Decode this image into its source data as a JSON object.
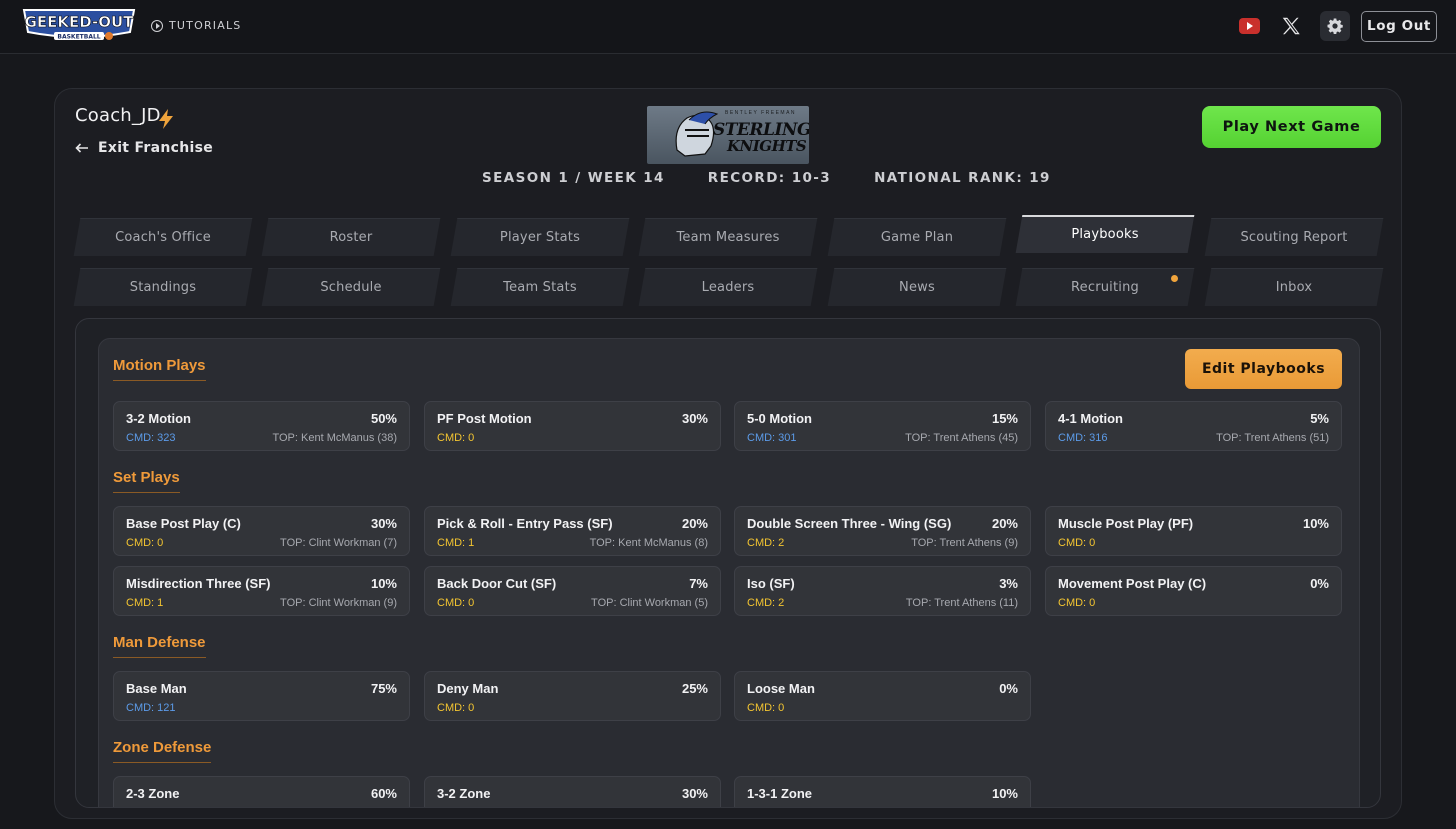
{
  "header": {
    "tutorials_label": "TUTORIALS",
    "logout_label": "Log Out",
    "icons": [
      "youtube-icon",
      "x-icon",
      "gear-icon"
    ]
  },
  "franchise": {
    "coach_name": "Coach_JD",
    "exit_label": "Exit Franchise",
    "team_logo_line0": "BENTLEY FREEMAN",
    "team_logo_line1": "STERLING",
    "team_logo_line2": "KNIGHTS",
    "season": "SEASON 1 / WEEK 14",
    "record": "RECORD: 10-3",
    "rank": "NATIONAL RANK: 19",
    "play_next_label": "Play Next Game"
  },
  "tabs_row1": [
    "Coach's Office",
    "Roster",
    "Player Stats",
    "Team Measures",
    "Game Plan",
    "Playbooks",
    "Scouting Report"
  ],
  "tabs_row2": [
    "Standings",
    "Schedule",
    "Team Stats",
    "Leaders",
    "News",
    "Recruiting",
    "Inbox"
  ],
  "active_tab": "Playbooks",
  "edit_label": "Edit Playbooks",
  "sections": {
    "motion": {
      "title": "Motion Plays",
      "cards": [
        {
          "name": "3-2 Motion",
          "pct": "50%",
          "cmd": "CMD: 323",
          "top": "TOP: Kent McManus (38)"
        },
        {
          "name": "PF Post Motion",
          "pct": "30%",
          "cmd": "CMD: 0",
          "top": ""
        },
        {
          "name": "5-0 Motion",
          "pct": "15%",
          "cmd": "CMD: 301",
          "top": "TOP: Trent Athens (45)"
        },
        {
          "name": "4-1 Motion",
          "pct": "5%",
          "cmd": "CMD: 316",
          "top": "TOP: Trent Athens (51)"
        }
      ]
    },
    "set": {
      "title": "Set Plays",
      "cards": [
        {
          "name": "Base Post Play (C)",
          "pct": "30%",
          "cmd": "CMD: 0",
          "top": "TOP: Clint Workman (7)"
        },
        {
          "name": "Pick & Roll - Entry Pass (SF)",
          "pct": "20%",
          "cmd": "CMD: 1",
          "top": "TOP: Kent McManus (8)"
        },
        {
          "name": "Double Screen Three - Wing (SG)",
          "pct": "20%",
          "cmd": "CMD: 2",
          "top": "TOP: Trent Athens (9)"
        },
        {
          "name": "Muscle Post Play (PF)",
          "pct": "10%",
          "cmd": "CMD: 0",
          "top": ""
        },
        {
          "name": "Misdirection Three (SF)",
          "pct": "10%",
          "cmd": "CMD: 1",
          "top": "TOP: Clint Workman (9)"
        },
        {
          "name": "Back Door Cut (SF)",
          "pct": "7%",
          "cmd": "CMD: 0",
          "top": "TOP: Clint Workman (5)"
        },
        {
          "name": "Iso (SF)",
          "pct": "3%",
          "cmd": "CMD: 2",
          "top": "TOP: Trent Athens (11)"
        },
        {
          "name": "Movement Post Play (C)",
          "pct": "0%",
          "cmd": "CMD: 0",
          "top": ""
        }
      ]
    },
    "man": {
      "title": "Man Defense",
      "cards": [
        {
          "name": "Base Man",
          "pct": "75%",
          "cmd": "CMD: 121",
          "top": ""
        },
        {
          "name": "Deny Man",
          "pct": "25%",
          "cmd": "CMD: 0",
          "top": ""
        },
        {
          "name": "Loose Man",
          "pct": "0%",
          "cmd": "CMD: 0",
          "top": ""
        }
      ]
    },
    "zone": {
      "title": "Zone Defense",
      "cards": [
        {
          "name": "2-3 Zone",
          "pct": "60%",
          "cmd": "",
          "top": ""
        },
        {
          "name": "3-2 Zone",
          "pct": "30%",
          "cmd": "",
          "top": ""
        },
        {
          "name": "1-3-1 Zone",
          "pct": "10%",
          "cmd": "",
          "top": ""
        }
      ]
    }
  },
  "colors": {
    "accent_orange": "#ef9a3a",
    "play_green": "#5fdc3c",
    "cmd_yellow": "#f3c531",
    "cmd_blue": "#5c9be8"
  }
}
